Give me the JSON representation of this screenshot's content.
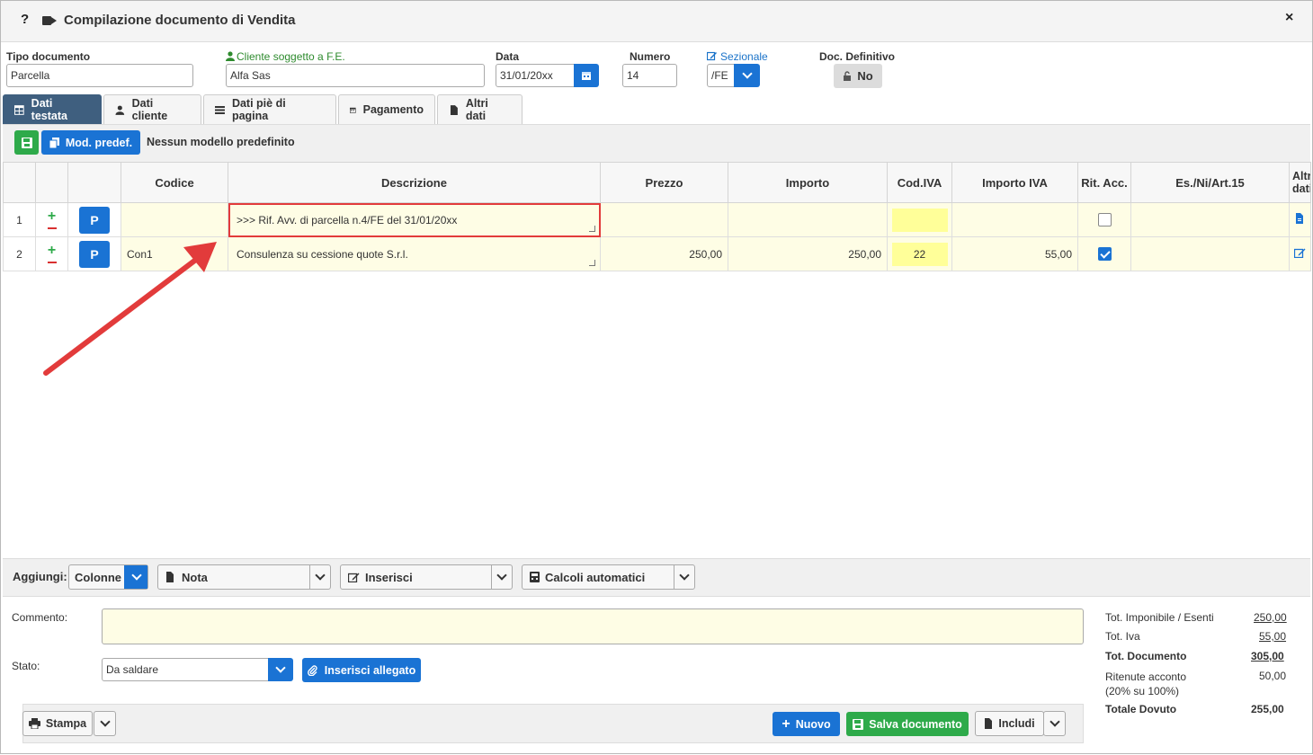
{
  "window": {
    "title": "Compilazione documento di Vendita",
    "help": "?",
    "close": "×"
  },
  "header": {
    "tipo_label": "Tipo documento",
    "tipo_value": "Parcella",
    "cliente_label": "Cliente soggetto a F.E.",
    "cliente_value": "Alfa Sas",
    "data_label": "Data",
    "data_value": "31/01/20xx",
    "numero_label": "Numero",
    "numero_value": "14",
    "sezionale_label": "Sezionale",
    "sezionale_value": "/FE",
    "definitivo_label": "Doc. Definitivo",
    "definitivo_value": "No"
  },
  "tabs": [
    {
      "label": "Dati testata",
      "icon": "table-icon",
      "active": true
    },
    {
      "label": "Dati cliente",
      "icon": "user-icon"
    },
    {
      "label": "Dati piè di pagina",
      "icon": "list-icon"
    },
    {
      "label": "Pagamento",
      "icon": "calendar-icon"
    },
    {
      "label": "Altri dati",
      "icon": "file-icon"
    }
  ],
  "toolbar": {
    "mod_label": "Mod. predef.",
    "model_text": "Nessun modello predefinito"
  },
  "grid": {
    "headers": [
      "Codice",
      "Descrizione",
      "Prezzo",
      "Importo",
      "Cod.IVA",
      "Importo IVA",
      "Rit. Acc.",
      "Es./Ni/Art.15",
      "Altri dati"
    ],
    "p_label": "P",
    "rows": [
      {
        "n": "1",
        "codice": "",
        "descrizione": ">>> Rif. Avv. di parcella n.4/FE del 31/01/20xx",
        "prezzo": "",
        "importo": "",
        "iva": "",
        "importo_iva": "",
        "rit": false
      },
      {
        "n": "2",
        "codice": "Con1",
        "descrizione": "Consulenza su cessione quote S.r.l.",
        "prezzo": "250,00",
        "importo": "250,00",
        "iva": "22",
        "importo_iva": "55,00",
        "rit": true
      }
    ]
  },
  "addbar": {
    "label": "Aggiungi:",
    "colonne": "Colonne",
    "nota": "Nota",
    "inserisci": "Inserisci",
    "calcoli": "Calcoli automatici"
  },
  "bottom": {
    "commento_label": "Commento:",
    "commento_value": "",
    "stato_label": "Stato:",
    "stato_value": "Da saldare",
    "allegato_label": "Inserisci allegato",
    "stampa": "Stampa",
    "nuovo": "Nuovo",
    "salva": "Salva documento",
    "includi": "Includi"
  },
  "totals": [
    {
      "label": "Tot. Imponibile / Esenti",
      "value": "250,00"
    },
    {
      "label": "Tot. Iva",
      "value": "55,00"
    },
    {
      "label": "Tot. Documento",
      "value": "305,00"
    },
    {
      "label": "Ritenute acconto (20% su 100%)",
      "value": "50,00"
    },
    {
      "label": "Totale Dovuto",
      "value": "255,00"
    }
  ],
  "colors": {
    "primary": "#1a73d4",
    "success": "#2eaa4a",
    "tab_active": "#3f5f7f",
    "row_bg": "#fefde5",
    "highlight": "#e23b3b"
  }
}
